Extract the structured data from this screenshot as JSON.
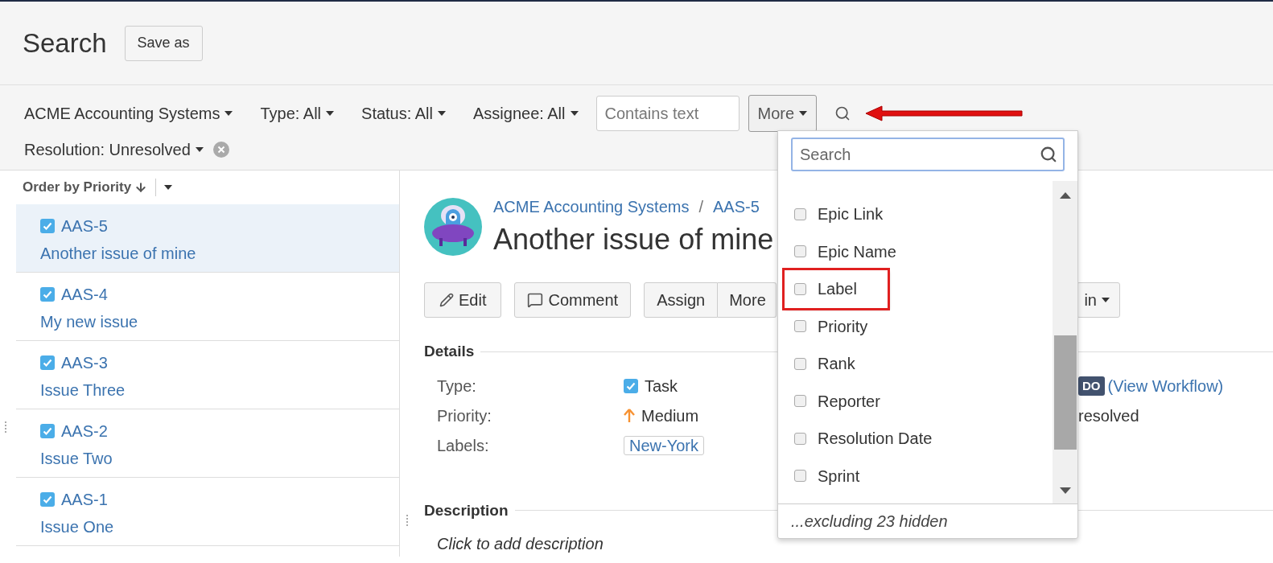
{
  "header": {
    "title": "Search",
    "save_button": "Save as"
  },
  "filters": [
    "ACME Accounting Systems",
    "Type: All",
    "Status: All",
    "Assignee: All"
  ],
  "text_search": {
    "placeholder": "Contains text"
  },
  "more_button": {
    "label": "More",
    "open": true
  },
  "resolution_filter": "Resolution: Unresolved",
  "issue_list": {
    "order_by": "Order by Priority",
    "issues": [
      {
        "key": "AAS-5",
        "summary": "Another issue of mine",
        "selected": true
      },
      {
        "key": "AAS-4",
        "summary": "My new issue",
        "selected": false
      },
      {
        "key": "AAS-3",
        "summary": "Issue Three",
        "selected": false
      },
      {
        "key": "AAS-2",
        "summary": "Issue Two",
        "selected": false
      },
      {
        "key": "AAS-1",
        "summary": "Issue One",
        "selected": false
      }
    ]
  },
  "issue": {
    "project": "ACME Accounting Systems",
    "separator": "/",
    "key": "AAS-5",
    "title": "Another issue of mine",
    "buttons": [
      {
        "label": "Edit",
        "kind": "edit"
      },
      {
        "label": "Comment",
        "kind": "comment"
      },
      {
        "label": "Assign",
        "kind": "group"
      },
      {
        "label": "More",
        "kind": "group"
      },
      {
        "label": "in",
        "kind": "menu"
      }
    ],
    "details_heading": "Details",
    "fields": [
      {
        "label": "Type:",
        "value": "Task",
        "kind": "type"
      },
      {
        "label": "Priority:",
        "value": "Medium",
        "kind": "priority"
      },
      {
        "label": "Labels:",
        "value": "New-York",
        "kind": "label"
      }
    ],
    "status": {
      "lozenge": "DO",
      "workflow_link": "(View Workflow)",
      "resolution": "resolved"
    },
    "description_heading": "Description",
    "description_placeholder": "Click to add description"
  },
  "more_menu": {
    "search": {
      "placeholder": "Search"
    },
    "items": [
      {
        "label": "Epic Link",
        "checked": false,
        "highlighted": false
      },
      {
        "label": "Epic Name",
        "checked": false,
        "highlighted": false
      },
      {
        "label": "Label",
        "checked": false,
        "highlighted": true
      },
      {
        "label": "Priority",
        "checked": false,
        "highlighted": false
      },
      {
        "label": "Rank",
        "checked": false,
        "highlighted": false
      },
      {
        "label": "Reporter",
        "checked": false,
        "highlighted": false
      },
      {
        "label": "Resolution Date",
        "checked": false,
        "highlighted": false
      },
      {
        "label": "Sprint",
        "checked": false,
        "highlighted": false
      }
    ],
    "footer": "...excluding 23 hidden"
  }
}
